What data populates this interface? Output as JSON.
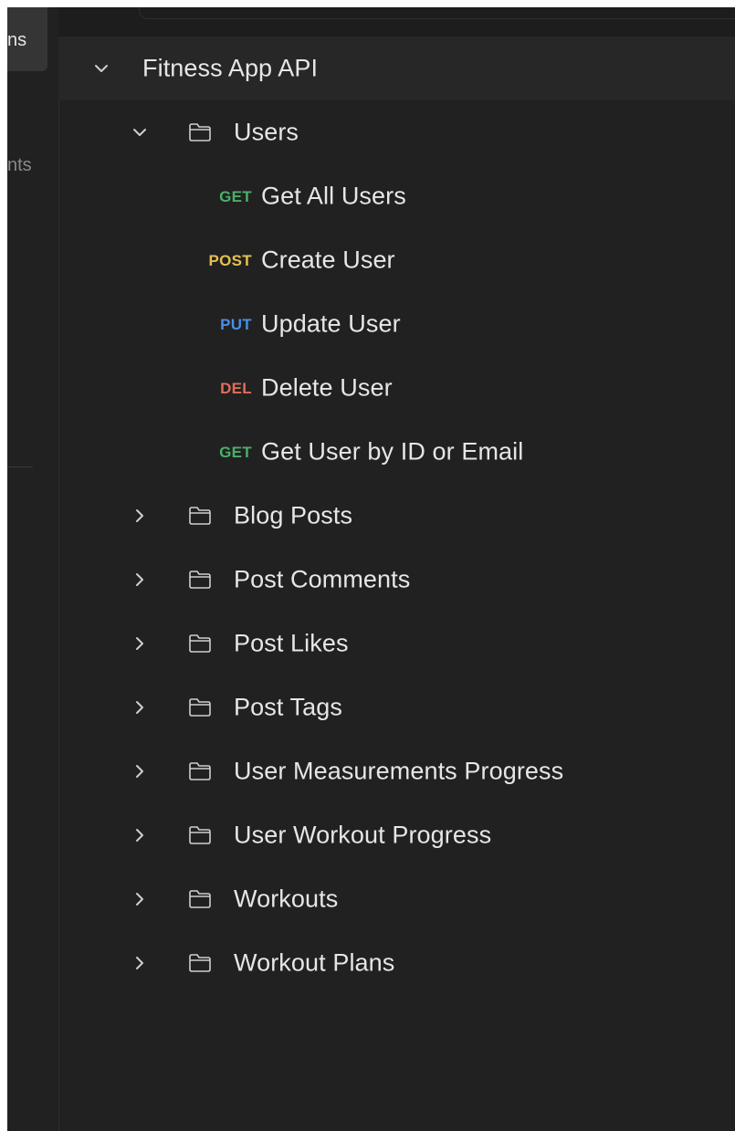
{
  "rail": {
    "tab_fragment": "ns",
    "item_fragment": "nts"
  },
  "collection": {
    "name": "Fitness App API",
    "expanded": true
  },
  "folders": [
    {
      "name": "Users",
      "expanded": true,
      "requests": [
        {
          "method": "GET",
          "name": "Get All Users",
          "color": "#4caf6a"
        },
        {
          "method": "POST",
          "name": "Create User",
          "color": "#e6c150"
        },
        {
          "method": "PUT",
          "name": "Update User",
          "color": "#4a8ee8"
        },
        {
          "method": "DEL",
          "name": "Delete User",
          "color": "#e06c5a"
        },
        {
          "method": "GET",
          "name": "Get User by ID or Email",
          "color": "#4caf6a"
        }
      ]
    },
    {
      "name": "Blog Posts",
      "expanded": false
    },
    {
      "name": "Post Comments",
      "expanded": false
    },
    {
      "name": "Post Likes",
      "expanded": false
    },
    {
      "name": "Post Tags",
      "expanded": false
    },
    {
      "name": "User Measurements Progress",
      "expanded": false
    },
    {
      "name": "User Workout Progress",
      "expanded": false
    },
    {
      "name": "Workouts",
      "expanded": false
    },
    {
      "name": "Workout Plans",
      "expanded": false
    }
  ],
  "icons": {
    "expanded": "chevron-down-icon",
    "collapsed": "chevron-right-icon",
    "folder": "folder-icon"
  }
}
